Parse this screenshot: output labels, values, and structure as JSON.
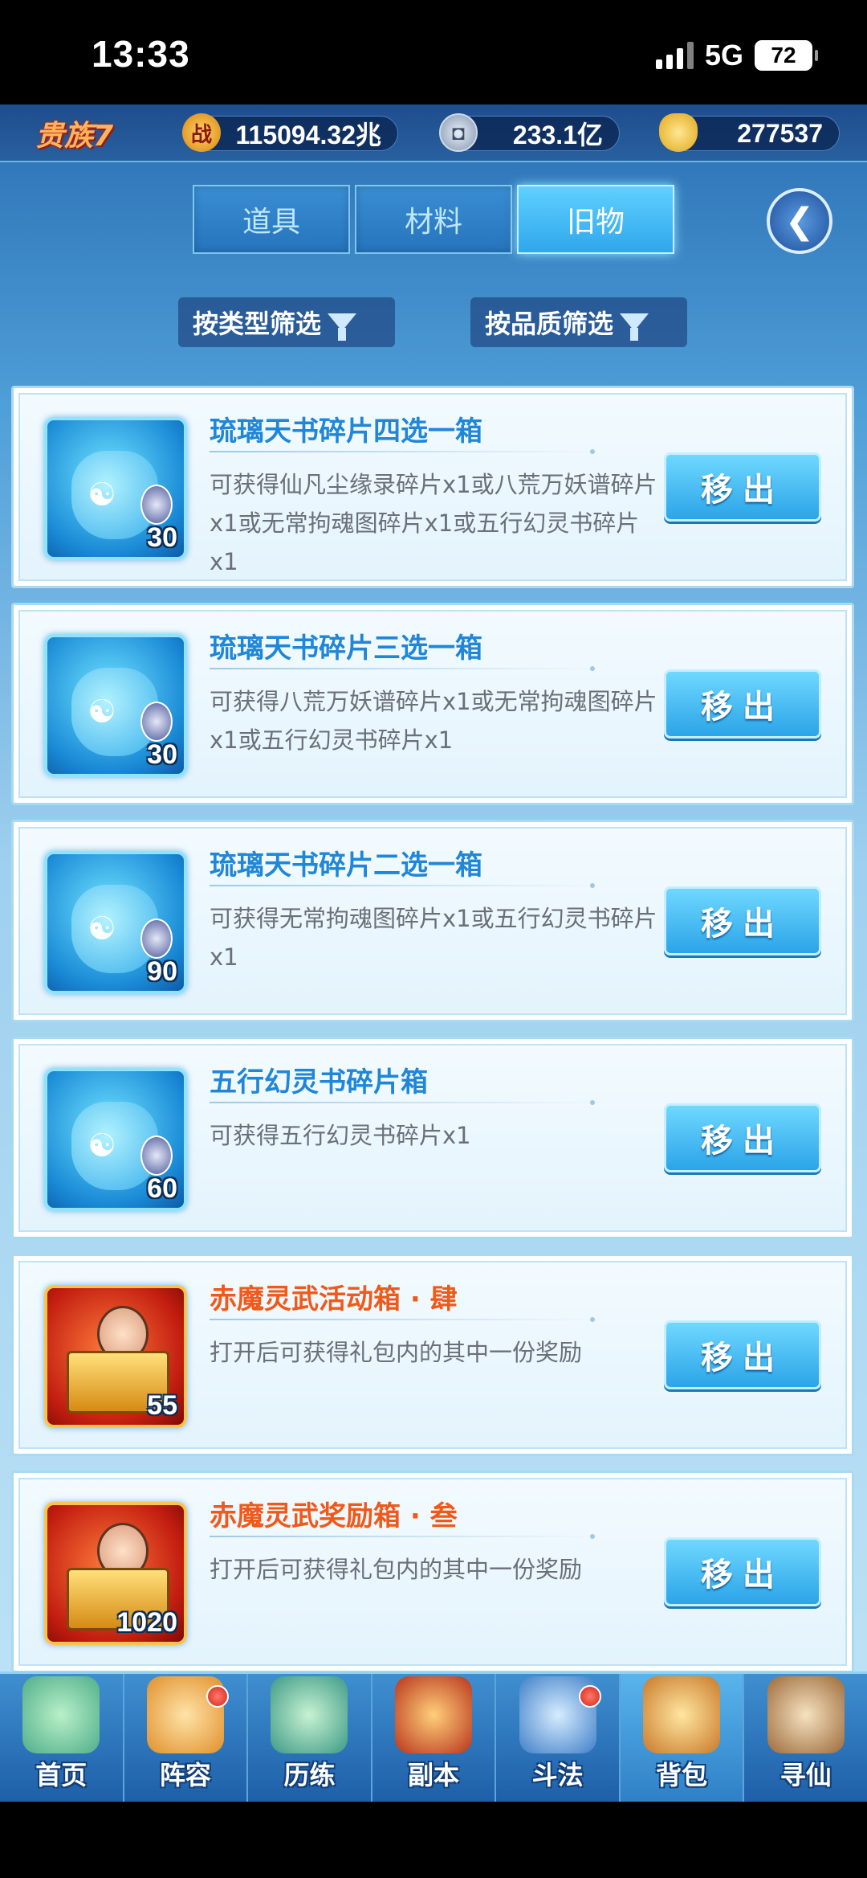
{
  "status_bar": {
    "time": "13:33",
    "network": "5G",
    "battery": "72"
  },
  "resources": {
    "vip": "贵族7",
    "power_icon_text": "战",
    "power": "115094.32兆",
    "silver": "233.1亿",
    "gold": "277537"
  },
  "tabs": [
    {
      "label": "道具",
      "active": false
    },
    {
      "label": "材料",
      "active": false
    },
    {
      "label": "旧物",
      "active": true
    }
  ],
  "filters": {
    "by_type": "按类型筛选",
    "by_quality": "按品质筛选"
  },
  "items": [
    {
      "title": "琉璃天书碎片四选一箱",
      "desc": "可获得仙凡尘缘录碎片x1或八荒万妖谱碎片x1或无常拘魂图碎片x1或五行幻灵书碎片x1",
      "count": "30",
      "button": "移出",
      "kind": "blue"
    },
    {
      "title": "琉璃天书碎片三选一箱",
      "desc": "可获得八荒万妖谱碎片x1或无常拘魂图碎片x1或五行幻灵书碎片x1",
      "count": "30",
      "button": "移出",
      "kind": "blue"
    },
    {
      "title": "琉璃天书碎片二选一箱",
      "desc": "可获得无常拘魂图碎片x1或五行幻灵书碎片x1",
      "count": "90",
      "button": "移出",
      "kind": "blue"
    },
    {
      "title": "五行幻灵书碎片箱",
      "desc": "可获得五行幻灵书碎片x1",
      "count": "60",
      "button": "移出",
      "kind": "blue"
    },
    {
      "title": "赤魔灵武活动箱 · 肆",
      "desc": "打开后可获得礼包内的其中一份奖励",
      "count": "55",
      "button": "移出",
      "kind": "red"
    },
    {
      "title": "赤魔灵武奖励箱 · 叁",
      "desc": "打开后可获得礼包内的其中一份奖励",
      "count": "1020",
      "button": "移出",
      "kind": "red"
    }
  ],
  "nav": [
    {
      "label": "首页",
      "icon": "home-icon",
      "badge": false,
      "active": false
    },
    {
      "label": "阵容",
      "icon": "lineup-icon",
      "badge": true,
      "active": false
    },
    {
      "label": "历练",
      "icon": "training-icon",
      "badge": false,
      "active": false
    },
    {
      "label": "副本",
      "icon": "dungeon-icon",
      "badge": false,
      "active": false
    },
    {
      "label": "斗法",
      "icon": "battle-icon",
      "badge": true,
      "active": false
    },
    {
      "label": "背包",
      "icon": "backpack-icon",
      "badge": false,
      "active": true
    },
    {
      "label": "寻仙",
      "icon": "seek-immortal-icon",
      "badge": false,
      "active": false
    }
  ],
  "colors": {
    "accent_blue": "#2ba4e8",
    "title_blue": "#1f86d8",
    "title_orange": "#f0591a"
  }
}
